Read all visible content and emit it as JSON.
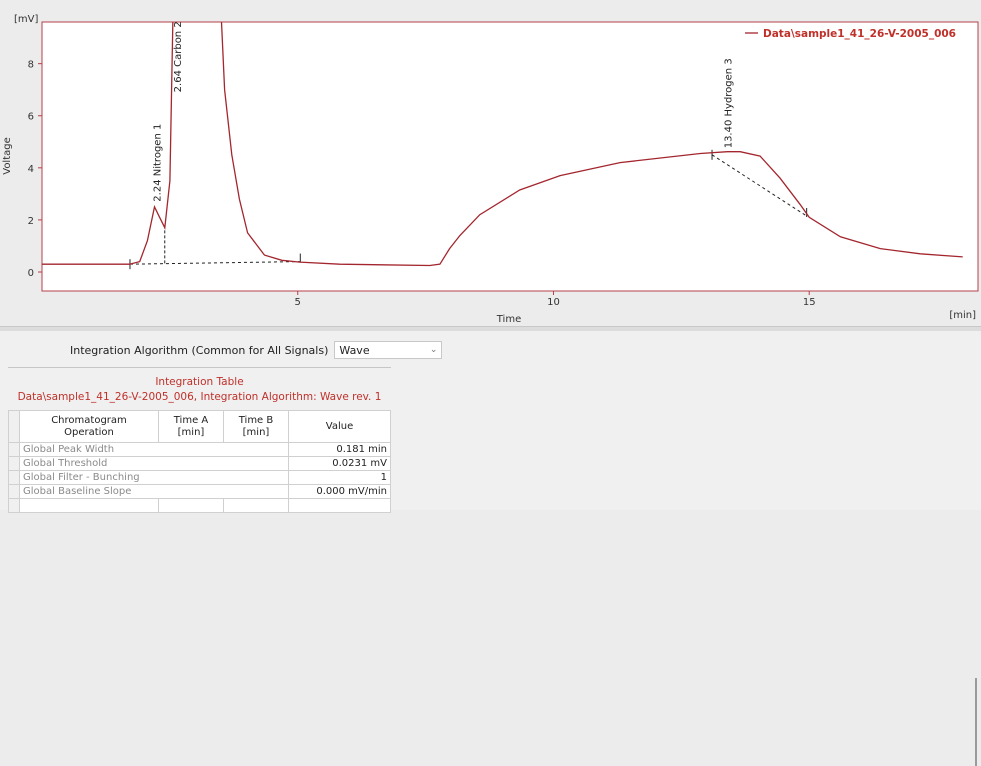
{
  "chart_data": {
    "type": "line",
    "xlabel": "Time",
    "ylabel": "Voltage",
    "x_unit": "[min]",
    "y_unit": "[mV]",
    "xlim": [
      0,
      18.3
    ],
    "ylim": [
      -0.73,
      9.6
    ],
    "x_ticks": [
      5,
      10,
      15
    ],
    "y_ticks": [
      0,
      2,
      4,
      6,
      8
    ],
    "grid": false,
    "legend_position": "top-right",
    "series": [
      {
        "name": "Data\\sample1_41_26-V-2005_006",
        "color": "#a3262e",
        "x": [
          0.0,
          1.0,
          1.71,
          1.91,
          2.06,
          2.2,
          2.3,
          2.4,
          2.5,
          2.58,
          3.0,
          3.45,
          3.51,
          3.57,
          3.71,
          3.86,
          4.02,
          4.35,
          4.69,
          5.04,
          5.82,
          7.58,
          7.78,
          7.97,
          8.17,
          8.56,
          9.34,
          10.13,
          11.3,
          12.87,
          13.4,
          13.65,
          14.04,
          14.43,
          14.82,
          15.0,
          15.61,
          16.39,
          17.17,
          18.0
        ],
        "y": [
          0.3,
          0.3,
          0.3,
          0.4,
          1.2,
          2.5,
          2.1,
          1.7,
          3.5,
          12,
          40,
          12,
          9.6,
          7.0,
          4.5,
          2.8,
          1.5,
          0.65,
          0.45,
          0.38,
          0.3,
          0.25,
          0.3,
          0.9,
          1.4,
          2.2,
          3.15,
          3.7,
          4.2,
          4.55,
          4.62,
          4.62,
          4.45,
          3.6,
          2.6,
          2.1,
          1.35,
          0.9,
          0.7,
          0.58
        ]
      }
    ],
    "baselines": [
      {
        "from": [
          1.72,
          0.3
        ],
        "to": [
          5.05,
          0.4
        ]
      },
      {
        "from": [
          13.1,
          4.5
        ],
        "to": [
          14.95,
          2.15
        ]
      }
    ],
    "peak_separator": {
      "x": 2.4,
      "y_from": 0.33,
      "y_to": 1.7
    },
    "peaks": [
      {
        "label": "2.24 Nitrogen  1",
        "time": 2.24
      },
      {
        "label": "2.64 Carbon  2",
        "time": 2.64
      },
      {
        "label": "13.40 Hydrogen  3",
        "time": 13.4
      }
    ]
  },
  "integration": {
    "algorithm_label": "Integration Algorithm (Common for All Signals)",
    "algorithm_value": "Wave",
    "table_title": "Integration Table",
    "table_subtitle": "Data\\sample1_41_26-V-2005_006, Integration Algorithm: Wave rev. 1",
    "columns": [
      "Chromatogram\nOperation",
      "Time A\n[min]",
      "Time B\n[min]",
      "Value"
    ],
    "rows": [
      {
        "operation": "Global Peak Width",
        "value": "0.181 min"
      },
      {
        "operation": "Global Threshold",
        "value": "0.0231 mV"
      },
      {
        "operation": "Global Filter - Bunching",
        "value": "1"
      },
      {
        "operation": "Global Baseline Slope",
        "value": "0.000 mV/min"
      }
    ]
  }
}
